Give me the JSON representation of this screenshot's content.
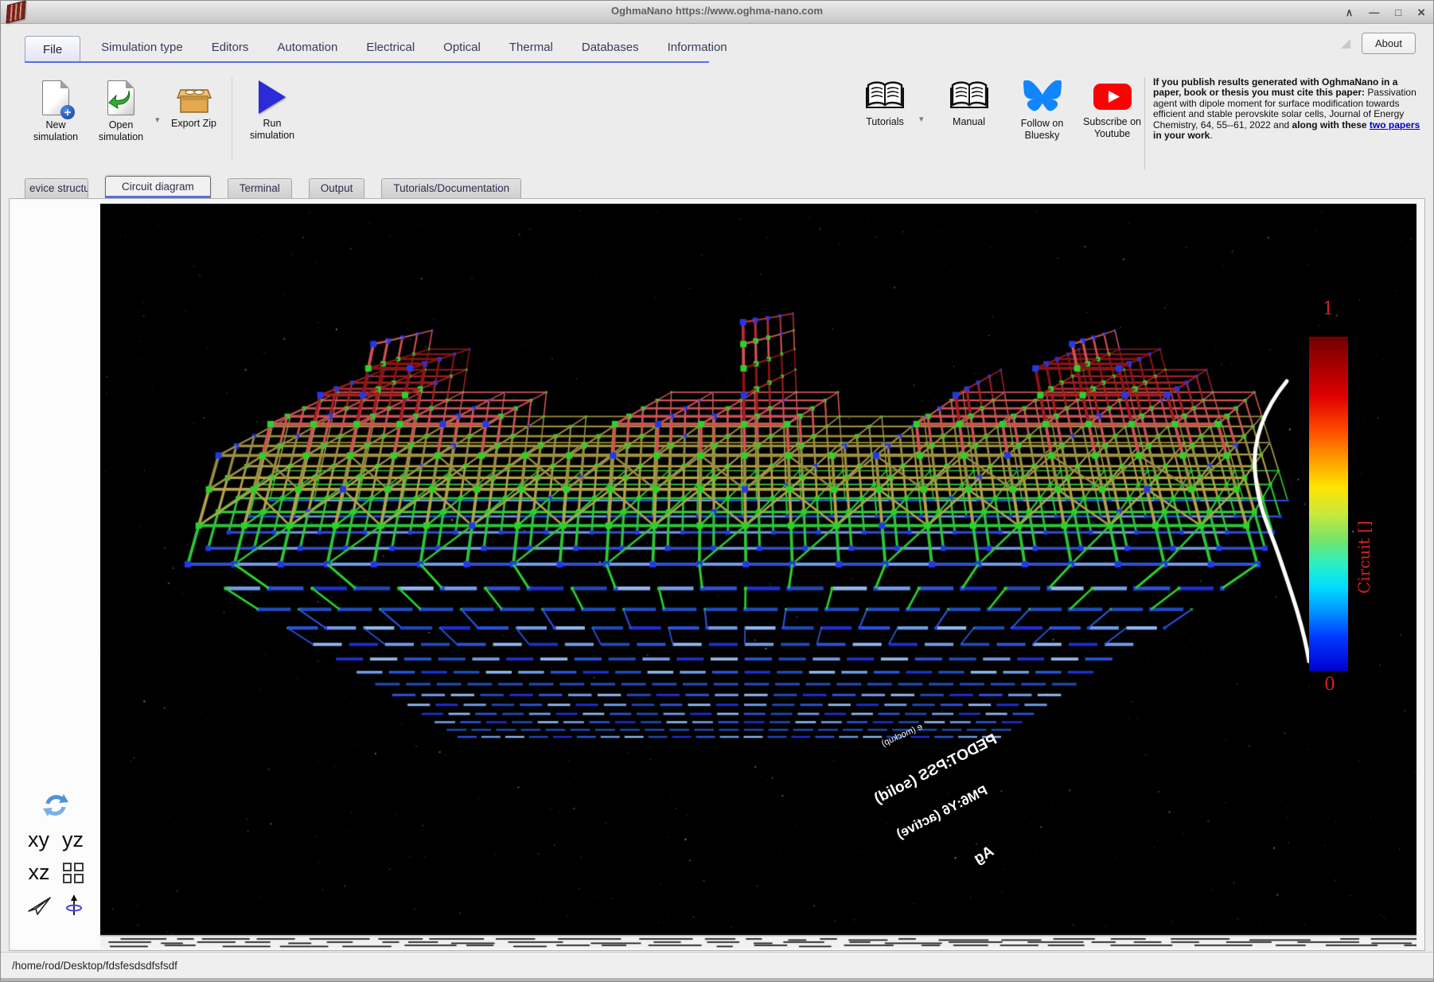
{
  "window": {
    "title": "OghmaNano https://www.oghma-nano.com",
    "controls": {
      "shade": "∧",
      "minimize": "—",
      "maximize": "□",
      "close": "×"
    },
    "about_label": "About"
  },
  "menu": {
    "active": "File",
    "items": [
      "File",
      "Simulation type",
      "Editors",
      "Automation",
      "Electrical",
      "Optical",
      "Thermal",
      "Databases",
      "Information"
    ]
  },
  "toolbar": {
    "buttons": [
      {
        "label": "New simulation",
        "icon": "new-document-icon"
      },
      {
        "label": "Open simulation",
        "icon": "open-document-icon"
      },
      {
        "label": "Export Zip",
        "icon": "zip-box-icon"
      },
      {
        "label": "Run simulation",
        "icon": "play-icon"
      }
    ],
    "right": [
      {
        "label": "Tutorials",
        "icon": "open-book-icon"
      },
      {
        "label": "Manual",
        "icon": "open-book-icon"
      },
      {
        "label": "Follow on Bluesky",
        "icon": "bluesky-butterfly-icon"
      },
      {
        "label": "Subscribe on Youtube",
        "icon": "youtube-icon"
      }
    ]
  },
  "citation": {
    "bold1": "If you publish results generated with OghmaNano in a paper, book or thesis you must cite this paper:",
    "normal1": " Passivation agent with dipole moment for surface modification towards efficient and stable perovskite solar cells, Journal of Energy Chemistry, 64, 55--61, 2022 and ",
    "bold2": "along with these ",
    "link": "two papers",
    "bold3": " in your work",
    "normal2": "."
  },
  "tabs": {
    "active": "Circuit diagram",
    "items": [
      "evice structur",
      "Circuit diagram",
      "Terminal",
      "Output",
      "Tutorials/Documentation"
    ]
  },
  "viewer": {
    "colorbar": {
      "max": "1",
      "min": "0",
      "label": "Circuit []"
    },
    "layers": [
      "e (mockup)",
      "PEDOT:PSS (solid)",
      "PM6:Y6 (active)",
      "Ag"
    ],
    "axis_buttons": {
      "xy": "xy",
      "yz": "yz",
      "xz": "xz"
    }
  },
  "scene": {
    "background": "#000000",
    "node_blue": "#2438e8",
    "node_green": "#2bd22b",
    "level_colors": [
      "#3f6bd6",
      "#2fc43a",
      "#b3a24b",
      "#9a8d3f",
      "#cf5353",
      "#a32020",
      "#8c1414",
      "#cf5353",
      "#b03030"
    ],
    "fan_blues": [
      "#1b2fd0",
      "#2a52d8",
      "#6f9ce8",
      "#8fb6f0",
      "#1e49b8"
    ],
    "curve_color": "#ffffff",
    "colorbar_text_color": "#d42020"
  },
  "statusbar": {
    "path": "/home/rod/Desktop/fdsfesdsdfsfsdf"
  }
}
